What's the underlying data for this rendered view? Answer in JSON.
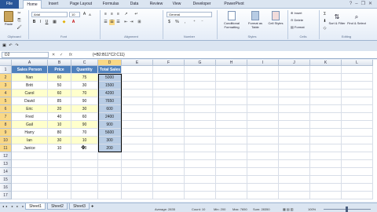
{
  "ribbon_tabs": [
    "File",
    "Home",
    "Insert",
    "Page Layout",
    "Formulas",
    "Data",
    "Review",
    "View",
    "Developer",
    "PowerPivot"
  ],
  "active_tab": "Home",
  "clipboard": {
    "group_label": "Clipboard",
    "paste_label": "Paste"
  },
  "font": {
    "group_label": "Font",
    "name": "Arial",
    "size": "10"
  },
  "alignment": {
    "group_label": "Alignment"
  },
  "number": {
    "group_label": "Number",
    "format": "General"
  },
  "styles": {
    "group_label": "Styles",
    "conditional": "Conditional Formatting",
    "format_table": "Format as Table",
    "cell_styles": "Cell Styles"
  },
  "cells": {
    "group_label": "Cells",
    "insert": "Insert",
    "delete": "Delete",
    "format": "Format"
  },
  "editing": {
    "group_label": "Editing",
    "sort": "Sort & Filter",
    "find": "Find & Select"
  },
  "name_box": "D2",
  "fx_label": "fx",
  "formula": "{=B2:B11*C2:C11}",
  "columns": [
    "A",
    "B",
    "C",
    "D",
    "E",
    "F",
    "G",
    "H",
    "I",
    "J",
    "K",
    "L"
  ],
  "rows": [
    "1",
    "2",
    "3",
    "4",
    "5",
    "6",
    "7",
    "8",
    "9",
    "10",
    "11",
    "12",
    "13",
    "14",
    "15",
    "16",
    "17"
  ],
  "table": {
    "headers": [
      "Sales Person",
      "Price",
      "Quantity",
      "Total Sales"
    ],
    "data": [
      [
        "Nan",
        "60",
        "75",
        "5000"
      ],
      [
        "Britt",
        "50",
        "30",
        "1500"
      ],
      [
        "Carol",
        "60",
        "70",
        "4200"
      ],
      [
        "David",
        "85",
        "90",
        "7650"
      ],
      [
        "Eric",
        "20",
        "30",
        "600"
      ],
      [
        "Fred",
        "40",
        "60",
        "2400"
      ],
      [
        "Gail",
        "10",
        "90",
        "900"
      ],
      [
        "Harry",
        "80",
        "70",
        "5600"
      ],
      [
        "Ian",
        "30",
        "10",
        "300"
      ],
      [
        "Janice",
        "10",
        "20",
        "200"
      ]
    ]
  },
  "sheets": [
    "Sheet1",
    "Sheet2",
    "Sheet3"
  ],
  "active_sheet": "Sheet1",
  "status": {
    "average": "Average: 2835",
    "count": "Count: 10",
    "min": "Min: 200",
    "max": "Max: 7650",
    "sum": "Sum: 28350",
    "zoom": "100%"
  },
  "colors": {
    "header_bg": "#4f81bd",
    "row_alt": "#ffffcc",
    "selection": "#b8cce4"
  }
}
